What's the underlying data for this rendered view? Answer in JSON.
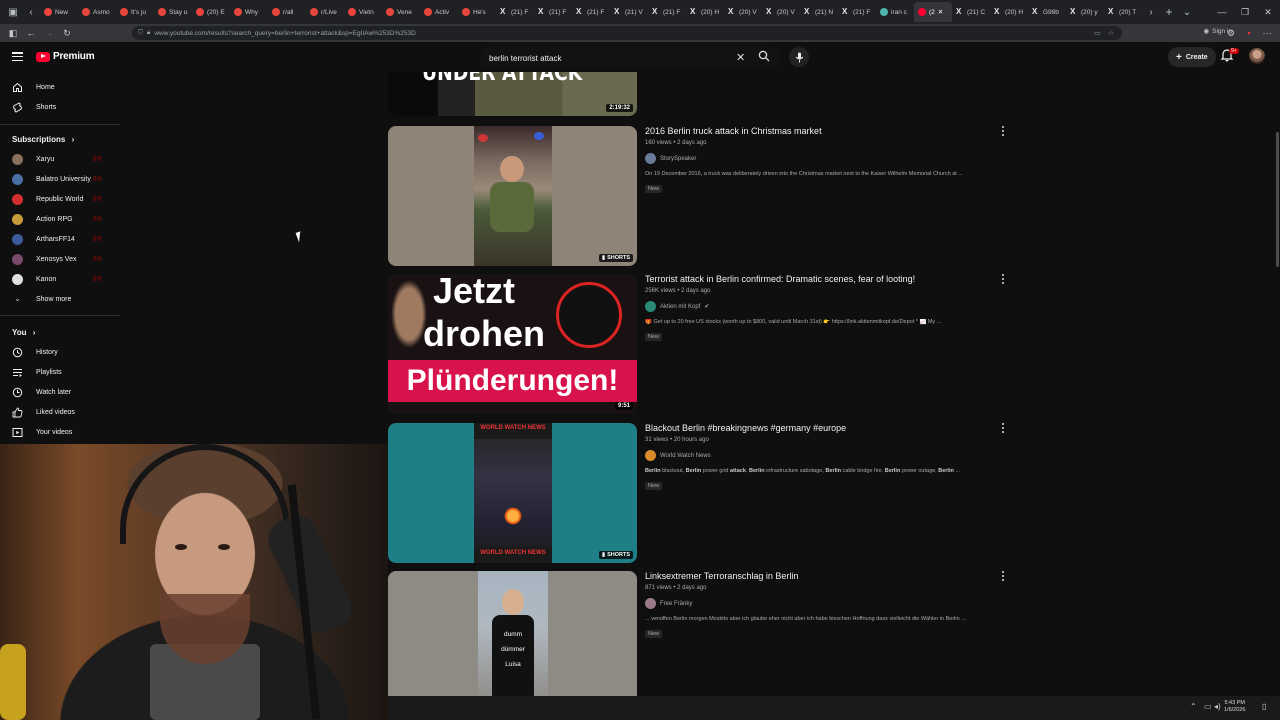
{
  "browser": {
    "tabs": [
      {
        "label": "New",
        "icon": "reddit"
      },
      {
        "label": "Asmo",
        "icon": "reddit"
      },
      {
        "label": "It's ju",
        "icon": "reddit"
      },
      {
        "label": "Stay u",
        "icon": "reddit"
      },
      {
        "label": "(20) E",
        "icon": "reddit"
      },
      {
        "label": "Why",
        "icon": "reddit"
      },
      {
        "label": "r/all",
        "icon": "reddit"
      },
      {
        "label": "r/Live",
        "icon": "reddit"
      },
      {
        "label": "Vietn",
        "icon": "reddit"
      },
      {
        "label": "Vene",
        "icon": "reddit"
      },
      {
        "label": "Activ",
        "icon": "reddit"
      },
      {
        "label": "He's",
        "icon": "reddit"
      },
      {
        "label": "(21) F",
        "icon": "x"
      },
      {
        "label": "(21) F",
        "icon": "x"
      },
      {
        "label": "(21) F",
        "icon": "x"
      },
      {
        "label": "(21) V",
        "icon": "x"
      },
      {
        "label": "(21) F",
        "icon": "x"
      },
      {
        "label": "(20) H",
        "icon": "x"
      },
      {
        "label": "(20) V",
        "icon": "x"
      },
      {
        "label": "(20) V",
        "icon": "x"
      },
      {
        "label": "(21) N",
        "icon": "x"
      },
      {
        "label": "(21) F",
        "icon": "x"
      },
      {
        "label": "iran c",
        "icon": "globe"
      },
      {
        "label": "(2",
        "icon": "youtube",
        "active": true
      },
      {
        "label": "(21) C",
        "icon": "x"
      },
      {
        "label": "(20) H",
        "icon": "x"
      },
      {
        "label": "G98b",
        "icon": "x"
      },
      {
        "label": "(20) y",
        "icon": "x"
      },
      {
        "label": "(20) T",
        "icon": "x"
      }
    ],
    "url": "www.youtube.com/results?search_query=berlin+terrorist+attack&sp=EgIIAw%253D%253D",
    "signin_label": "Sign in"
  },
  "header": {
    "logo_text": "Premium",
    "search_value": "berlin terrorist attack",
    "create_label": "Create",
    "notif_badge": "9+"
  },
  "sidebar": {
    "nav": [
      {
        "label": "Home",
        "icon": "home-icon"
      },
      {
        "label": "Shorts",
        "icon": "shorts-icon"
      }
    ],
    "subs_heading": "Subscriptions",
    "subs": [
      {
        "label": "Xaryu",
        "color": "#8a6f5c"
      },
      {
        "label": "Balatro University",
        "color": "#4a6fa5"
      },
      {
        "label": "Republic World",
        "color": "#d32f2f"
      },
      {
        "label": "Action RPG",
        "color": "#c79a3a"
      },
      {
        "label": "ArtharsFF14",
        "color": "#3b5a9a"
      },
      {
        "label": "Xenosys Vex",
        "color": "#7a4a6a"
      },
      {
        "label": "Kanon",
        "color": "#e0e0e0"
      }
    ],
    "show_more": "Show more",
    "you_heading": "You",
    "you_items": [
      {
        "label": "History",
        "icon": "history-icon"
      },
      {
        "label": "Playlists",
        "icon": "playlists-icon"
      },
      {
        "label": "Watch later",
        "icon": "watch-later-icon"
      },
      {
        "label": "Liked videos",
        "icon": "liked-icon"
      },
      {
        "label": "Your videos",
        "icon": "your-videos-icon"
      }
    ]
  },
  "results": [
    {
      "title": "",
      "duration": "2:19:32",
      "thumb_text": "UNDER ATTACK"
    },
    {
      "title": "2016 Berlin truck attack in Christmas market",
      "meta": "160 views • 2 days ago",
      "channel": "StorySpeaker",
      "desc": "On 19 December 2016, a truck was deliberately driven into the Christmas market next to the Kaiser Wilhelm Memorial Church at ...",
      "badge": "New",
      "shorts": "SHORTS"
    },
    {
      "title": "Terrorist attack in Berlin confirmed: Dramatic scenes, fear of looting!",
      "meta": "256K views • 2 days ago",
      "channel": "Aktien mit Kopf",
      "desc": "🎁 Get up to 20 free US stocks (worth up to $800, valid until March 31st) 👉 https://link.aktienmitkopf.de/Depot * 📈 My ...",
      "badge": "New",
      "duration": "9:51",
      "thumb_line1": "Jetzt",
      "thumb_line2": "drohen",
      "thumb_line3": "Plünderungen!"
    },
    {
      "title": "Blackout Berlin #breakingnews #germany #europe",
      "meta": "31 views • 20 hours ago",
      "channel": "World Watch News",
      "desc_parts": [
        "Berlin",
        " blackout, ",
        "Berlin",
        " power grid ",
        "attack",
        ", ",
        "Berlin",
        " infrastructure sabotage, ",
        "Berlin",
        " cable bridge fire, ",
        "Berlin",
        " power outage, ",
        "Berlin",
        " ..."
      ],
      "badge": "New",
      "shorts": "SHORTS",
      "thumb_banner": "WORLD WATCH NEWS"
    },
    {
      "title": "Linksextremer Terroranschlag in Berlin",
      "meta": "871 views • 2 days ago",
      "channel": "Free Fränky",
      "desc": "... versiffen Berlin morgen Moskito aber ich glaube eher nicht aber ich habe bisschen Hoffnung dass vielleicht die Wähler in Berlin ...",
      "badge": "New",
      "thumb_words": [
        "dumm",
        "dümmer",
        "Luisa"
      ]
    }
  ],
  "taskbar": {
    "time": "5:43 PM",
    "date": "1/6/2026"
  }
}
